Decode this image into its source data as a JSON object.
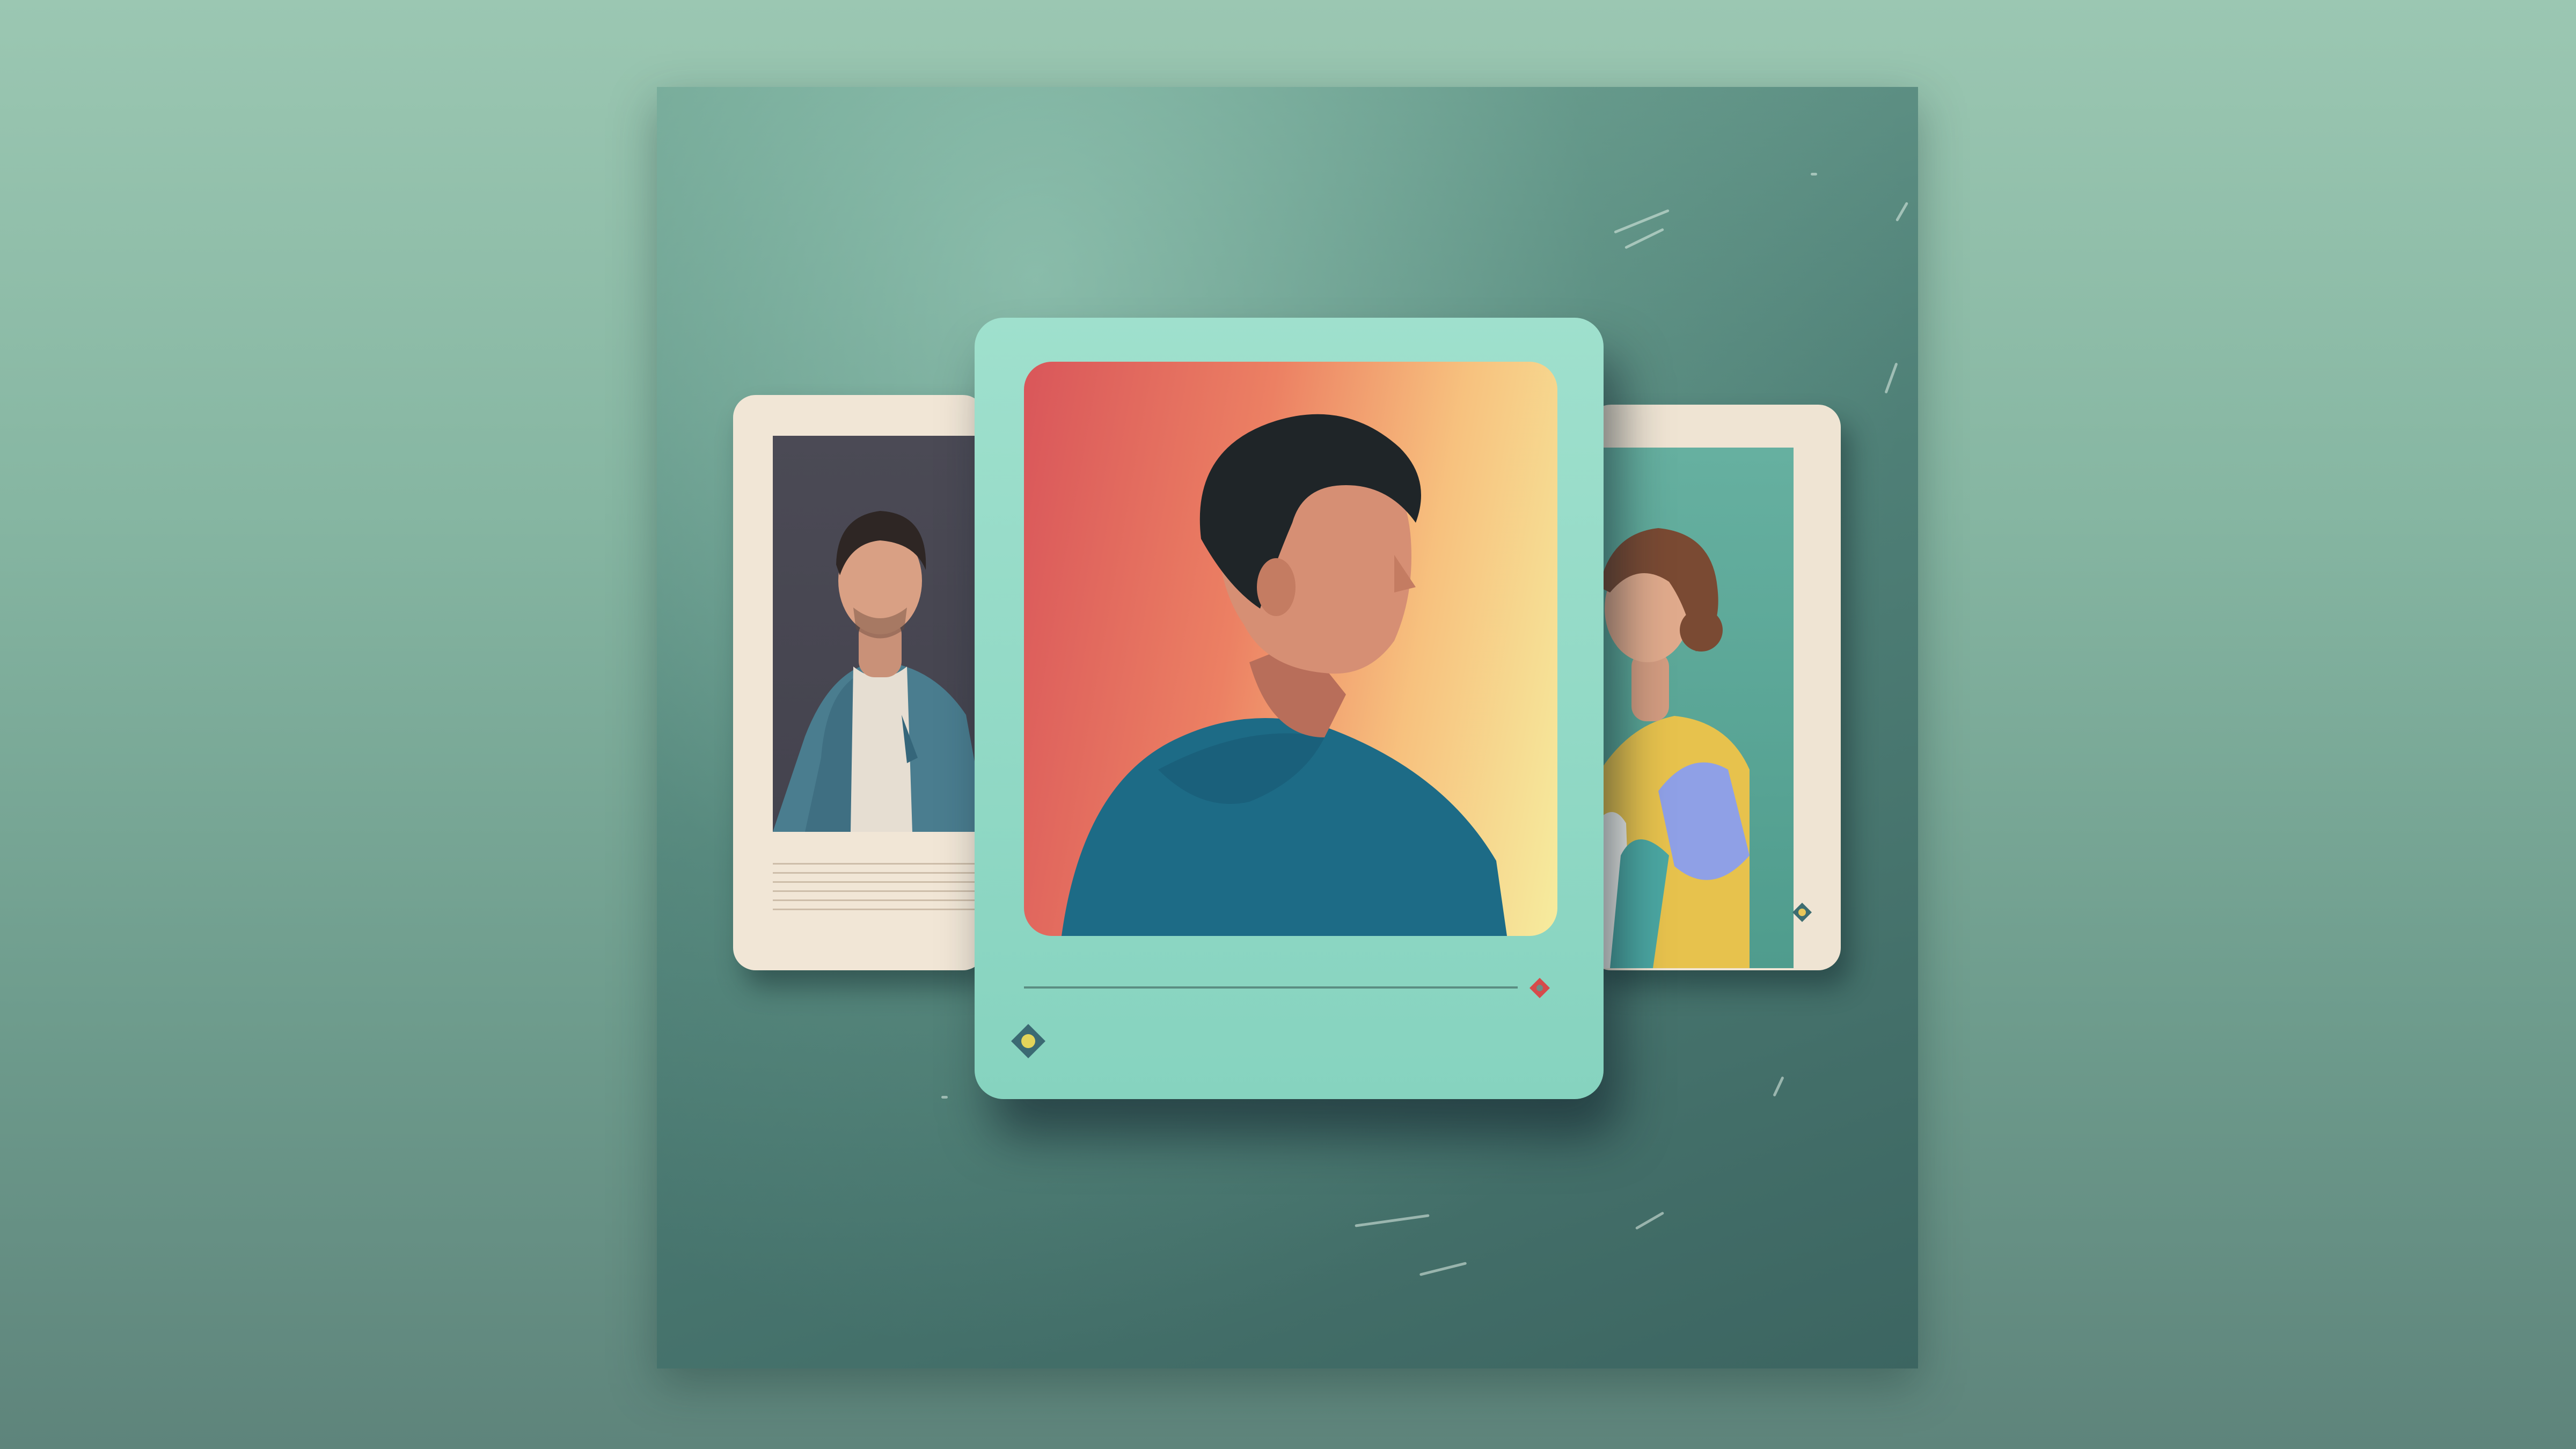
{
  "scene": {
    "subject": "profile-cards",
    "colors": {
      "background": "#8ebca8",
      "panel": "#4f8077",
      "center_card": "#90d8c4",
      "side_card": "#f1e6d6",
      "accent_red": "#d9565a",
      "accent_yellow": "#f6ec9e"
    },
    "icons": {
      "center_badge": "diamond-badge-icon",
      "center_marker": "red-diamond-icon",
      "right_marker": "small-diamond-icon"
    }
  }
}
